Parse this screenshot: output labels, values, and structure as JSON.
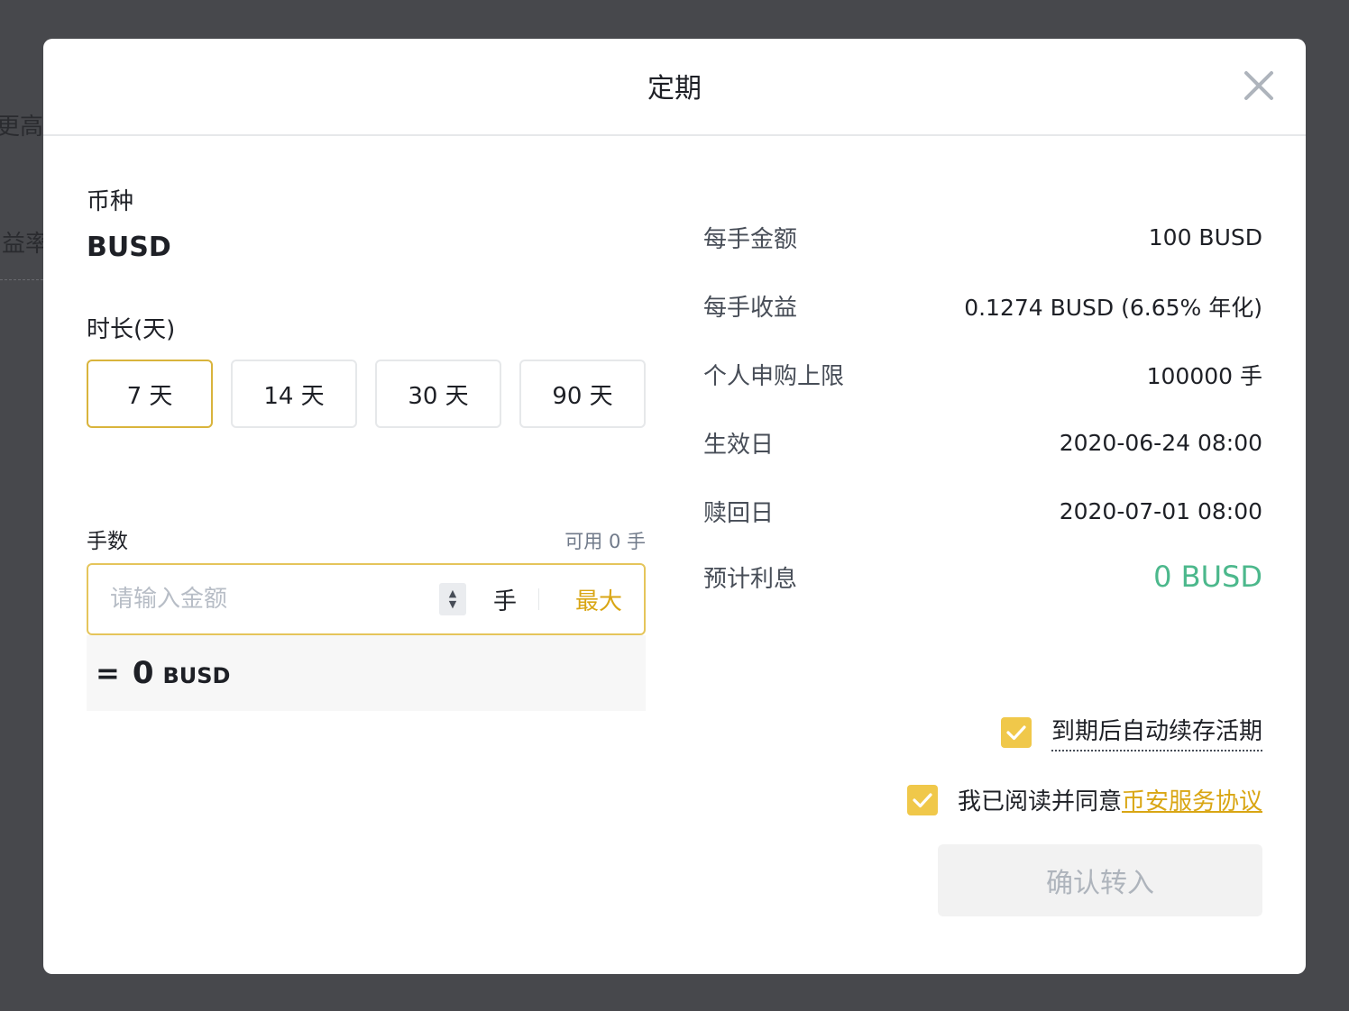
{
  "background": {
    "text_top": "更高",
    "text_mid": "益率"
  },
  "modal": {
    "title": "定期"
  },
  "left": {
    "coin_label": "币种",
    "coin_value": "BUSD",
    "duration_label": "时长(天)",
    "durations": [
      "7 天",
      "14 天",
      "30 天",
      "90 天"
    ],
    "selected_duration": "7 天",
    "lots_label": "手数",
    "available": "可用 0 手",
    "input_placeholder": "请输入金额",
    "input_value": "",
    "unit": "手",
    "max_label": "最大",
    "result_eq": "=",
    "result_num": "0",
    "result_currency": "BUSD"
  },
  "right": {
    "rows": [
      {
        "key": "每手金额",
        "value": "100 BUSD"
      },
      {
        "key": "每手收益",
        "value": "0.1274 BUSD (6.65% 年化)"
      },
      {
        "key": "个人申购上限",
        "value": "100000 手"
      },
      {
        "key": "生效日",
        "value": "2020-06-24 08:00"
      },
      {
        "key": "赎回日",
        "value": "2020-07-01 08:00"
      },
      {
        "key": "预计利息",
        "value": "0 BUSD"
      }
    ]
  },
  "agreements": {
    "auto_renew": "到期后自动续存活期",
    "agree_prefix": "我已阅读并同意",
    "agree_link": "币安服务协议"
  },
  "confirm_label": "确认转入",
  "colors": {
    "accent": "#f0c84a",
    "accent_text": "#d9a614",
    "positive": "#4cb88c",
    "overlay": "#47484c"
  }
}
